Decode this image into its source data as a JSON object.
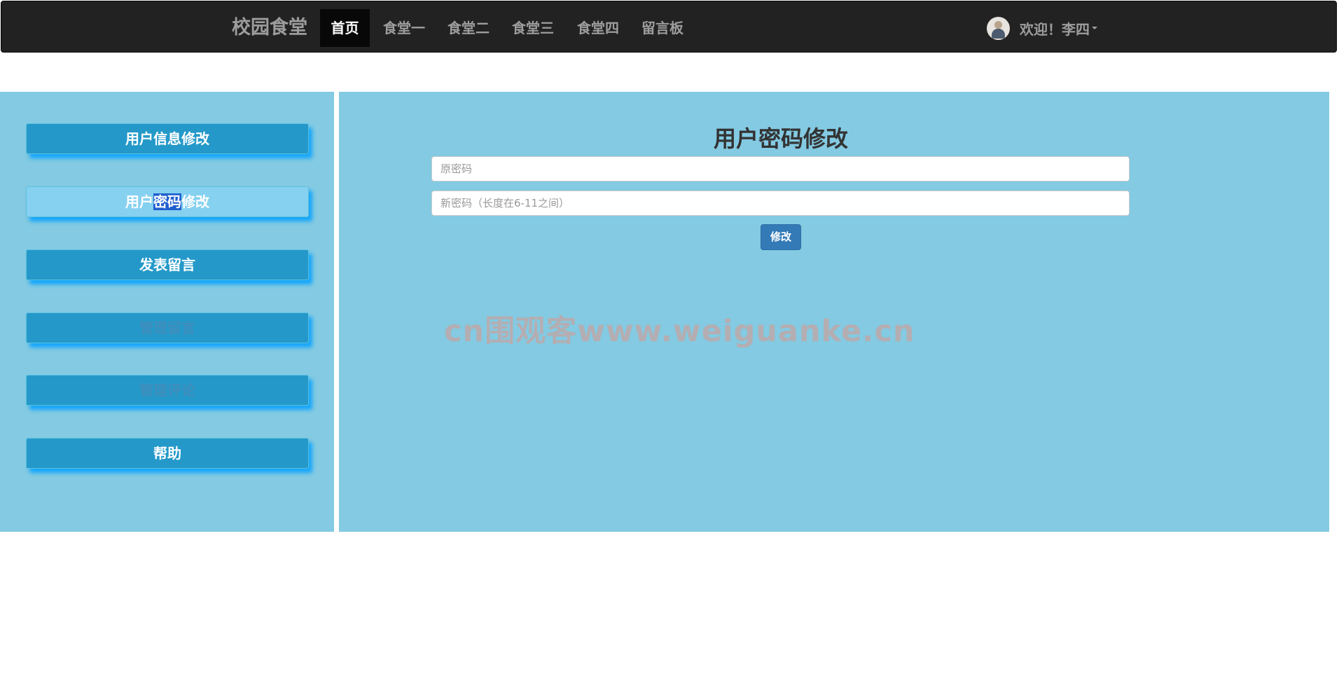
{
  "navbar": {
    "brand": "校园食堂",
    "items": [
      {
        "label": "首页",
        "active": true
      },
      {
        "label": "食堂一"
      },
      {
        "label": "食堂二"
      },
      {
        "label": "食堂三"
      },
      {
        "label": "食堂四"
      },
      {
        "label": "留言板"
      }
    ],
    "user": {
      "avatar_icon": "user-avatar-icon",
      "welcome": "欢迎！李四"
    }
  },
  "sidebar": {
    "items": [
      {
        "label": "用户信息修改"
      },
      {
        "label_pre": "用户",
        "label_hl": "密码",
        "label_post": "修改",
        "active": true
      },
      {
        "label": "发表留言"
      },
      {
        "label": "管理留言",
        "muted": true
      },
      {
        "label": "管理评论",
        "muted": true
      },
      {
        "label": "帮助"
      }
    ]
  },
  "main": {
    "title": "用户密码修改",
    "old_password_placeholder": "原密码",
    "new_password_placeholder": "新密码（长度在6-11之间）",
    "submit_label": "修改"
  },
  "watermark": "cn围观客www.weiguanke.cn",
  "colors": {
    "navbar_bg": "#222222",
    "panel_bg": "#83cae2",
    "button_bg": "#2499c9",
    "submit_bg": "#337ab7"
  }
}
